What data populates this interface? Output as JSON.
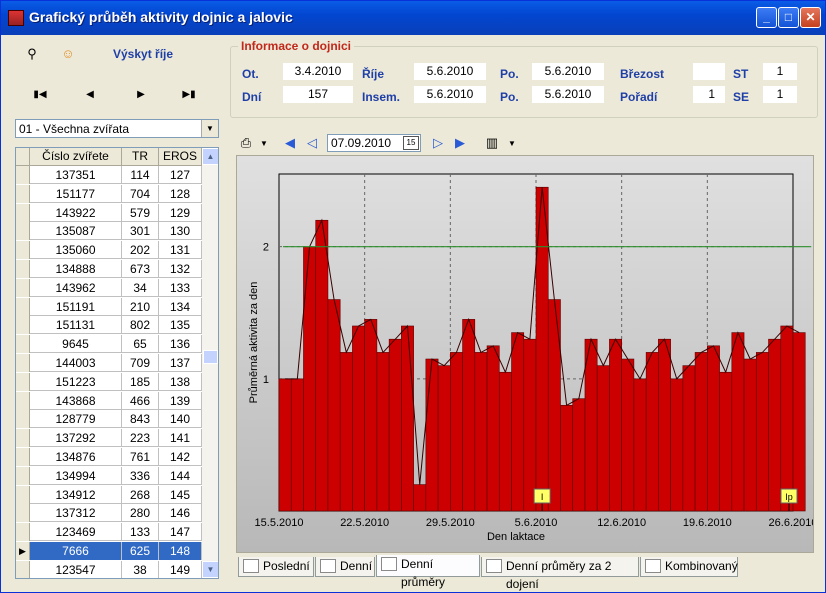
{
  "window": {
    "title": "Grafický průběh aktivity dojnic a jalovic"
  },
  "toolbar": {
    "link_label": "Výskyt říje"
  },
  "filter": {
    "selected": "01 - Všechna zvířata"
  },
  "grid": {
    "headers": [
      "Číslo zvířete",
      "TR",
      "EROS"
    ],
    "rows": [
      [
        "137351",
        "114",
        "127"
      ],
      [
        "151177",
        "704",
        "128"
      ],
      [
        "143922",
        "579",
        "129"
      ],
      [
        "135087",
        "301",
        "130"
      ],
      [
        "135060",
        "202",
        "131"
      ],
      [
        "134888",
        "673",
        "132"
      ],
      [
        "143962",
        "34",
        "133"
      ],
      [
        "151191",
        "210",
        "134"
      ],
      [
        "151131",
        "802",
        "135"
      ],
      [
        "9645",
        "65",
        "136"
      ],
      [
        "144003",
        "709",
        "137"
      ],
      [
        "151223",
        "185",
        "138"
      ],
      [
        "143868",
        "466",
        "139"
      ],
      [
        "128779",
        "843",
        "140"
      ],
      [
        "137292",
        "223",
        "141"
      ],
      [
        "134876",
        "761",
        "142"
      ],
      [
        "134994",
        "336",
        "144"
      ],
      [
        "134912",
        "268",
        "145"
      ],
      [
        "137312",
        "280",
        "146"
      ],
      [
        "123469",
        "133",
        "147"
      ],
      [
        "7666",
        "625",
        "148"
      ],
      [
        "123547",
        "38",
        "149"
      ]
    ],
    "selected_index": 20
  },
  "info": {
    "title": "Informace o dojnici",
    "labels": {
      "ot": "Ot.",
      "dni": "Dní",
      "rije": "Říje",
      "insem": "Insem.",
      "po1": "Po.",
      "po2": "Po.",
      "brezost": "Březost",
      "poradi": "Pořadí",
      "st": "ST",
      "se": "SE"
    },
    "values": {
      "ot": "3.4.2010",
      "dni": "157",
      "rije": "5.6.2010",
      "insem": "5.6.2010",
      "po1": "5.6.2010",
      "po2": "5.6.2010",
      "brezost": "",
      "poradi": "1",
      "st": "1",
      "se": "1"
    }
  },
  "chart_toolbar": {
    "date": "07.09.2010"
  },
  "tabs": [
    "Poslední",
    "Denní",
    "Denní průměry",
    "Denní průměry za 2 dojení",
    "Kombinovaný"
  ],
  "active_tab": 2,
  "chart_data": {
    "type": "area",
    "xlabel": "Den laktace",
    "ylabel": "Průměrná aktivita za den",
    "x_tick_labels": [
      "15.5.2010",
      "22.5.2010",
      "29.5.2010",
      "5.6.2010",
      "12.6.2010",
      "19.6.2010",
      "26.6.2010"
    ],
    "y_tick_labels": [
      "1",
      "2"
    ],
    "ylim": [
      0,
      2.55
    ],
    "threshold": 2.0,
    "markers": [
      {
        "label": "I",
        "x_day": 21
      },
      {
        "label": "Ip",
        "x_day": 42
      }
    ],
    "series": [
      {
        "values": [
          1.0,
          1.0,
          2.0,
          2.2,
          1.6,
          1.2,
          1.4,
          1.45,
          1.2,
          1.3,
          1.4,
          0.2,
          1.15,
          1.1,
          1.2,
          1.45,
          1.2,
          1.25,
          1.05,
          1.35,
          1.3,
          2.45,
          1.6,
          0.8,
          0.85,
          1.3,
          1.1,
          1.3,
          1.15,
          1.0,
          1.2,
          1.3,
          1.0,
          1.1,
          1.2,
          1.25,
          1.05,
          1.35,
          1.15,
          1.2,
          1.3,
          1.4,
          1.35
        ]
      }
    ],
    "colors": {
      "fill": "#cc0000",
      "threshold": "#2c8f2c",
      "bg_top": "#e0e0e0",
      "bg_bottom": "#b8b8b8"
    }
  }
}
